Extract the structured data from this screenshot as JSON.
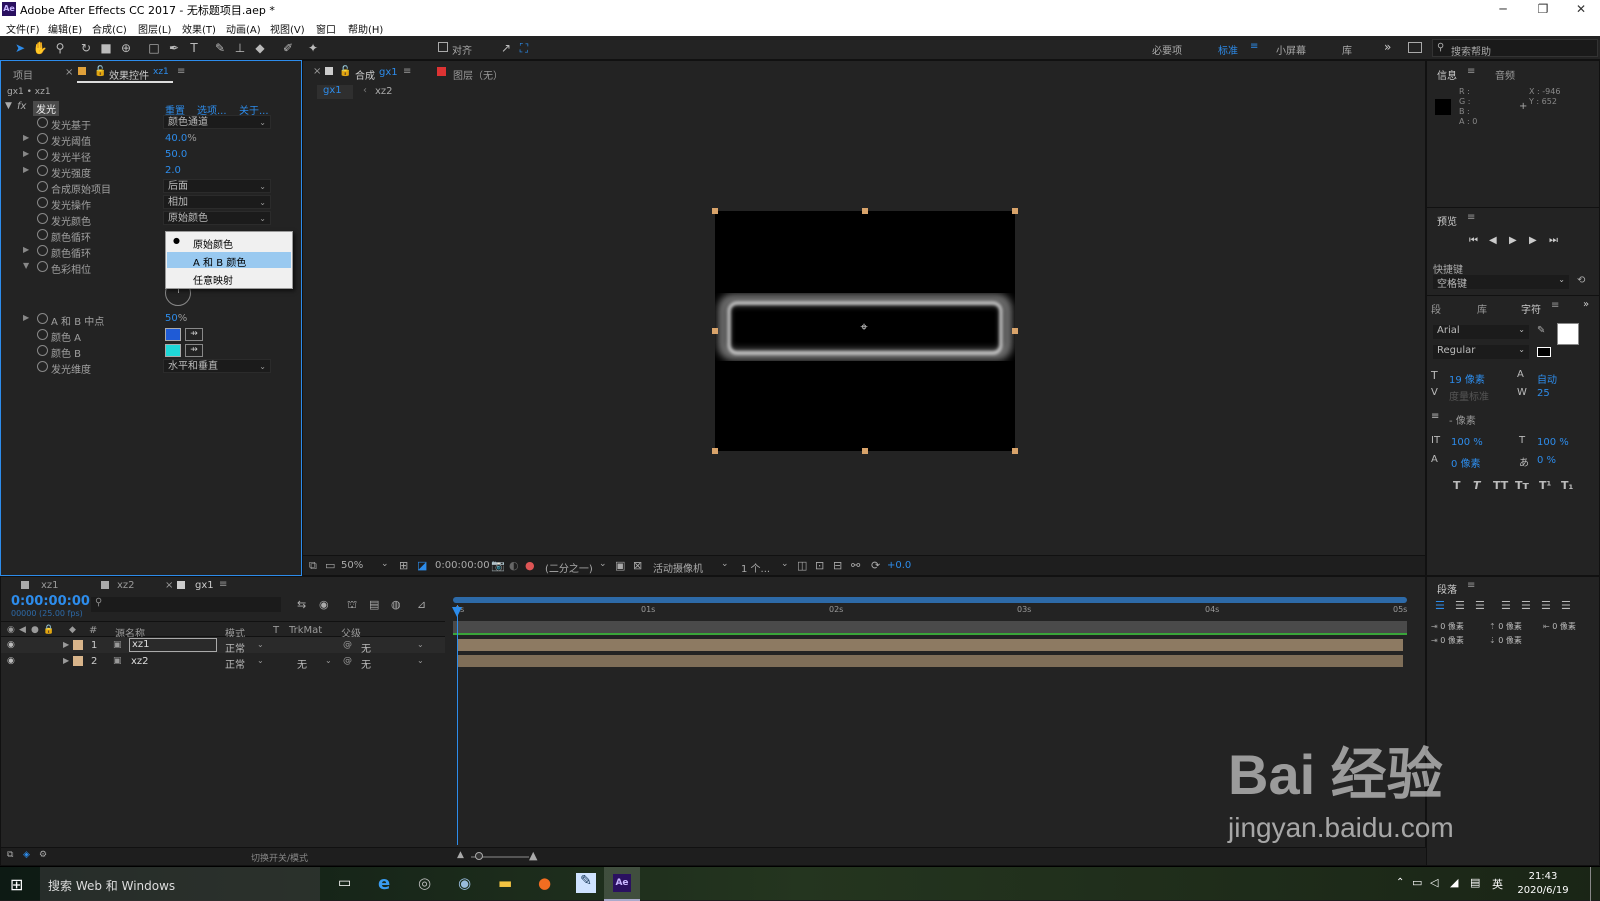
{
  "window": {
    "title": "Adobe After Effects CC 2017 - 无标题项目.aep *",
    "app_icon": "Ae",
    "minimize": "─",
    "maximize": "❐",
    "close": "✕"
  },
  "menu": [
    "文件(F)",
    "编辑(E)",
    "合成(C)",
    "图层(L)",
    "效果(T)",
    "动画(A)",
    "视图(V)",
    "窗口",
    "帮助(H)"
  ],
  "toolbar": {
    "align_label": "对齐",
    "workspaces": [
      "必要项",
      "标准",
      "小屏幕",
      "库"
    ],
    "active_workspace": "标准",
    "search_placeholder": "搜索帮助"
  },
  "left_panel": {
    "tab_project": "项目",
    "tab_effects": "效果控件",
    "tab_effects_layer": "xz1",
    "breadcrumb": "gx1 • xz1",
    "effect": {
      "fx_label": "fx",
      "name": "发光",
      "reset": "重置",
      "options": "选项...",
      "about": "关于..."
    },
    "props": [
      {
        "label": "发光基于",
        "dropdown": "颜色通道"
      },
      {
        "label": "发光阈值",
        "value": "40.0",
        "unit": "%"
      },
      {
        "label": "发光半径",
        "value": "50.0"
      },
      {
        "label": "发光强度",
        "value": "2.0"
      },
      {
        "label": "合成原始项目",
        "dropdown": "后面"
      },
      {
        "label": "发光操作",
        "dropdown": "相加"
      },
      {
        "label": "发光颜色",
        "dropdown": "原始颜色"
      },
      {
        "label": "颜色循环"
      },
      {
        "label": "颜色循环"
      },
      {
        "label": "色彩相位"
      },
      {
        "label": "A 和 B 中点",
        "value": "50",
        "unit": "%"
      },
      {
        "label": "颜色 A",
        "color": "#1f5bd6"
      },
      {
        "label": "颜色 B",
        "color": "#1fd8d8"
      },
      {
        "label": "发光维度",
        "dropdown": "水平和垂直"
      }
    ],
    "popup": {
      "options": [
        "原始颜色",
        "A 和 B 颜色",
        "任意映射"
      ],
      "selected_marker": "●",
      "checked_index": 0,
      "highlighted_index": 1
    }
  },
  "comp_panel": {
    "tab_comp": "合成",
    "tab_comp_name": "gx1",
    "tab_layer": "图层（无）",
    "subtabs": [
      "gx1",
      "xz2"
    ],
    "zoom": "50%",
    "timecode": "0:00:00:00",
    "resolution": "(二分之一)",
    "camera": "活动摄像机",
    "views": "1 个...",
    "exposure": "+0.0"
  },
  "right_panel": {
    "info_tab": "信息",
    "audio_tab": "音频",
    "info_rgba": [
      "R :",
      "G :",
      "B :",
      "A : 0"
    ],
    "info_x": "X : -946",
    "info_y": "Y : 652",
    "preview_tab": "预览",
    "shortcut_label": "快捷键",
    "shortcut_value": "空格键",
    "tabs2": [
      "段",
      "库",
      "字符"
    ],
    "font_name": "Arial",
    "font_style": "Regular",
    "font_size": "19 像素",
    "leading": "自动",
    "kerning": "度量标准",
    "tracking": "25",
    "stroke": "- 像素",
    "vscale": "100 %",
    "hscale": "100 %",
    "baseline": "0 像素",
    "tsume": "0 %",
    "type_styles": [
      "T",
      "T",
      "TT",
      "Tт",
      "T¹",
      "T₁"
    ],
    "para_tab": "段落",
    "para_values": [
      "0 像素",
      "0 像素",
      "0 像素",
      "0 像素",
      "0 像素"
    ]
  },
  "timeline": {
    "tabs": [
      "xz1",
      "xz2",
      "gx1"
    ],
    "active_tab": "gx1",
    "timecode": "0:00:00:00",
    "fps": "00000 (25.00 fps)",
    "col_num": "#",
    "col_source": "源名称",
    "col_mode": "模式",
    "col_t": "T",
    "col_trkmat": "TrkMat",
    "col_parent": "父级",
    "layers": [
      {
        "num": "1",
        "name": "xz1",
        "mode": "正常",
        "trkmat": "",
        "parent": "无"
      },
      {
        "num": "2",
        "name": "xz2",
        "mode": "正常",
        "trkmat": "无",
        "parent": "无"
      }
    ],
    "ruler": [
      "0s",
      "01s",
      "02s",
      "03s",
      "04s",
      "05s"
    ],
    "footer": "切换开关/模式"
  },
  "taskbar": {
    "search": "搜索 Web 和 Windows",
    "time": "21:43",
    "date": "2020/6/19",
    "ime": "英"
  },
  "watermark": {
    "brand": "Bai 经验",
    "url": "jingyan.baidu.com"
  }
}
